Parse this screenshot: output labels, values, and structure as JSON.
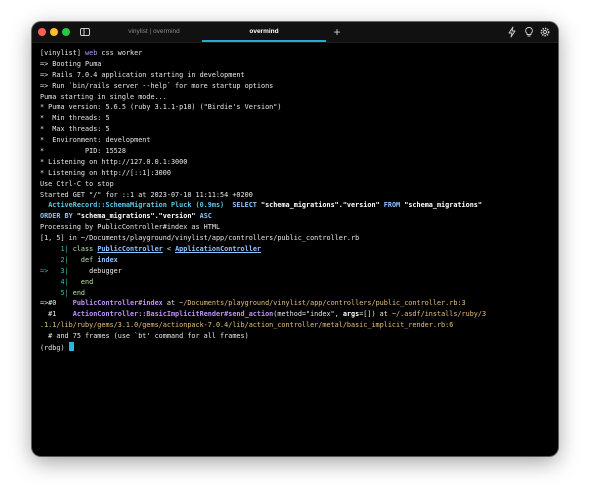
{
  "window": {
    "tabs": [
      {
        "label": "vinylist | overmind",
        "active": false
      },
      {
        "label": "overmind",
        "active": true
      }
    ],
    "new_tab": "+",
    "icons": [
      "sidebar-icon",
      "lightning-icon",
      "lightbulb-icon",
      "settings-icon"
    ]
  },
  "terminal": {
    "lines": [
      [
        {
          "t": "[vinylist] "
        },
        {
          "t": "web",
          "c": "c-purple"
        },
        {
          "t": " css worker"
        }
      ],
      [
        {
          "t": "=> Booting Puma"
        }
      ],
      [
        {
          "t": "=> Rails 7.0.4 application starting in development"
        }
      ],
      [
        {
          "t": "=> Run `bin/rails server --help` for more startup options"
        }
      ],
      [
        {
          "t": "Puma starting in single mode..."
        }
      ],
      [
        {
          "t": "* Puma version: 5.6.5 (ruby 3.1.1-p18) (\"Birdie's Version\")"
        }
      ],
      [
        {
          "t": "*  Min threads: 5"
        }
      ],
      [
        {
          "t": "*  Max threads: 5"
        }
      ],
      [
        {
          "t": "*  Environment: development"
        }
      ],
      [
        {
          "t": "*          PID: 15528"
        }
      ],
      [
        {
          "t": "* Listening on http://127.0.0.1:3000"
        }
      ],
      [
        {
          "t": "* Listening on http://[::1]:3000"
        }
      ],
      [
        {
          "t": "Use Ctrl-C to stop"
        }
      ],
      [
        {
          "t": "Started GET \"/\" for ::1 at 2023-07-18 11:11:54 +0200"
        }
      ],
      [
        {
          "t": "  "
        },
        {
          "t": "ActiveRecord::SchemaMigration Pluck (0.9ms)",
          "c": "c-cyan c-white-b"
        },
        {
          "t": "  "
        },
        {
          "t": "SELECT",
          "c": "c-blue"
        },
        {
          "t": " \"schema_migrations\".\"version\" ",
          "c": "c-white-b"
        },
        {
          "t": "FROM",
          "c": "c-blue"
        },
        {
          "t": " \"schema_migrations\"",
          "c": "c-white-b"
        }
      ],
      [
        {
          "t": "ORDER BY",
          "c": "c-blue"
        },
        {
          "t": " \"schema_migrations\".\"version\" ",
          "c": "c-white-b"
        },
        {
          "t": "ASC",
          "c": "c-blue"
        }
      ],
      [
        {
          "t": "Processing by PublicController#index as HTML"
        }
      ],
      [
        {
          "t": "[1, 5] in ~/Documents/playground/vinylist/app/controllers/public_controller.rb"
        }
      ],
      [
        {
          "t": "     1| ",
          "c": "c-teal"
        },
        {
          "t": "class",
          "c": "c-green"
        },
        {
          "t": " "
        },
        {
          "t": "PublicController",
          "c": "c-ul"
        },
        {
          "t": " < "
        },
        {
          "t": "ApplicationController",
          "c": "c-ul"
        }
      ],
      [
        {
          "t": "     2|   ",
          "c": "c-teal"
        },
        {
          "t": "def",
          "c": "c-green"
        },
        {
          "t": " "
        },
        {
          "t": "index",
          "c": "c-blue"
        }
      ],
      [
        {
          "t": "=>   3|     ",
          "c": "c-teal"
        },
        {
          "t": "debugger"
        }
      ],
      [
        {
          "t": "     4|   ",
          "c": "c-teal"
        },
        {
          "t": "end",
          "c": "c-green"
        }
      ],
      [
        {
          "t": "     5| ",
          "c": "c-teal"
        },
        {
          "t": "end",
          "c": "c-green"
        }
      ],
      [
        {
          "t": "=>#0    "
        },
        {
          "t": "PublicController#index",
          "c": "c-purple-b"
        },
        {
          "t": " at "
        },
        {
          "t": "~/Documents/playground/vinylist/app/controllers/public_controller.rb:3",
          "c": "c-yellow"
        }
      ],
      [
        {
          "t": "  #1    "
        },
        {
          "t": "ActionController::BasicImplicitRender#send_action",
          "c": "c-purple-b"
        },
        {
          "t": "(method=\"index\", "
        },
        {
          "t": "args",
          "c": "c-white-b"
        },
        {
          "t": "=[]) at "
        },
        {
          "t": "~/.asdf/installs/ruby/3",
          "c": "c-yellow"
        }
      ],
      [
        {
          "t": ".1.1/lib/ruby/gems/3.1.0/gems/actionpack-7.0.4/lib/action_controller/metal/basic_implicit_render.rb:6",
          "c": "c-yellow"
        }
      ],
      [
        {
          "t": "  # and 75 frames (use `bt' command for all frames)"
        }
      ],
      [
        {
          "t": "(rdbg) "
        }
      ]
    ]
  }
}
